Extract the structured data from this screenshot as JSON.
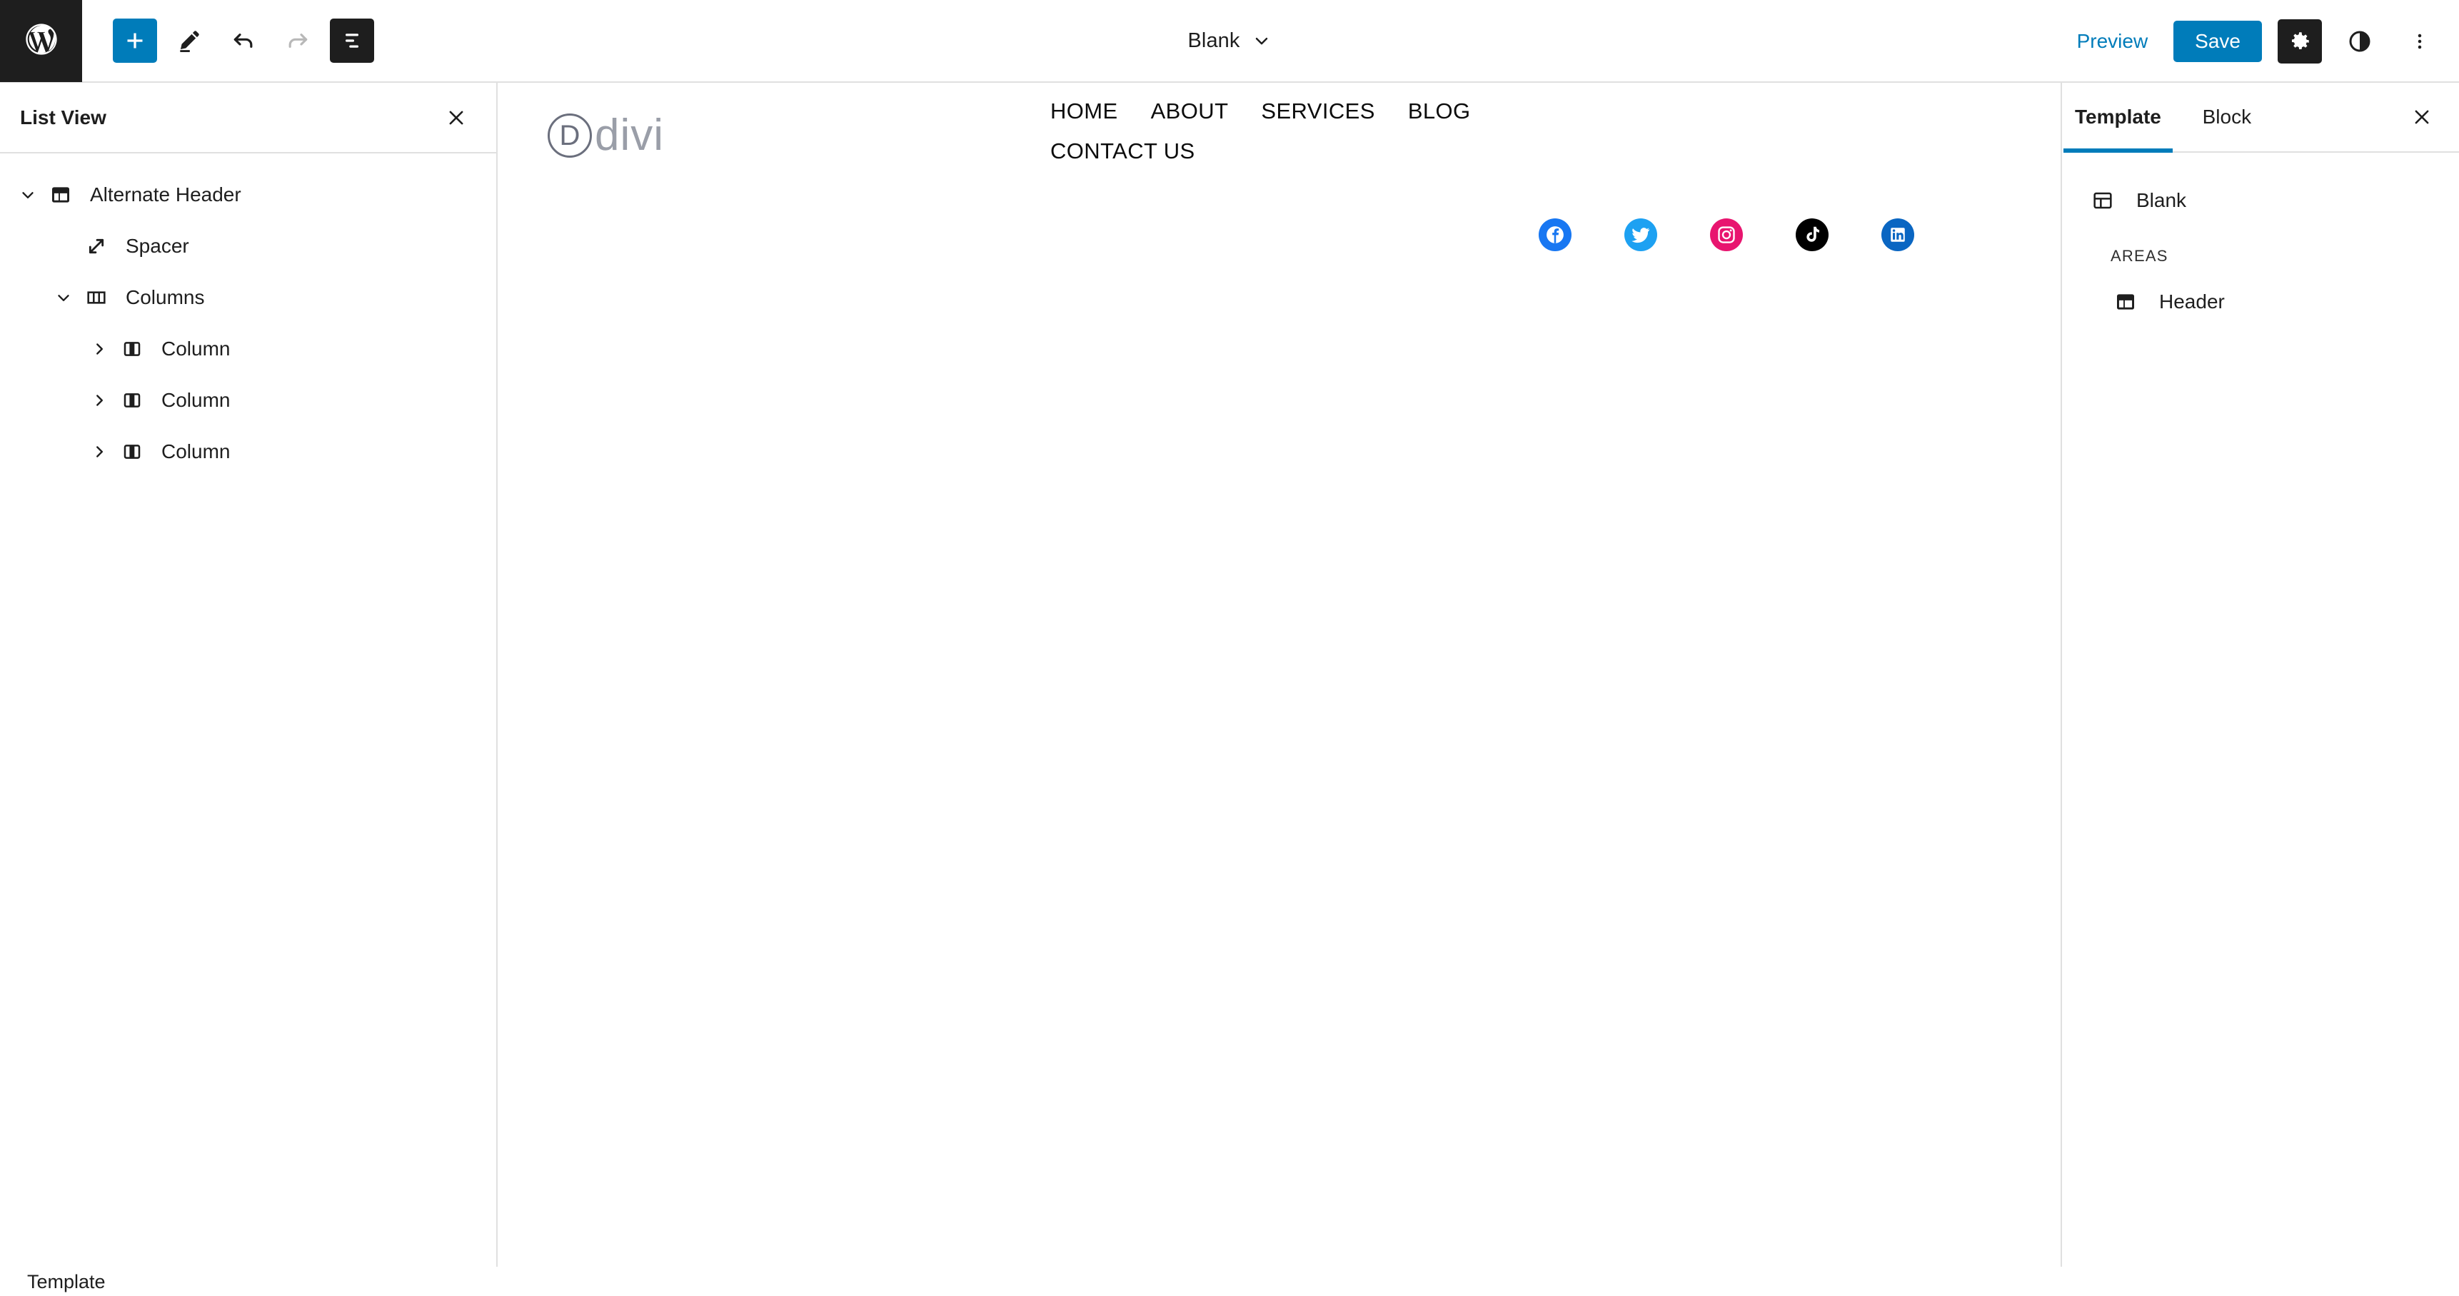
{
  "colors": {
    "accent": "#007cba",
    "dark": "#1e1e1e",
    "border": "#e0e0e0",
    "facebook": "#1877F2",
    "twitter": "#1DA1F2",
    "instagram": "#E8156F",
    "tiktok": "#000000",
    "linkedin": "#0A66C2",
    "divi_gray": "#6b6f7d",
    "divi_word_gray": "#9a9ea8"
  },
  "topbar": {
    "wp_logo_icon": "wordpress-logo-icon",
    "tools": [
      {
        "name": "add-block-button",
        "icon": "plus-icon",
        "style": "primary",
        "interactable": true
      },
      {
        "name": "edit-tools-button",
        "icon": "pencil-icon",
        "style": "plain",
        "interactable": true
      },
      {
        "name": "undo-button",
        "icon": "undo-icon",
        "style": "plain",
        "interactable": true
      },
      {
        "name": "redo-button",
        "icon": "redo-icon",
        "style": "disabled",
        "interactable": false
      },
      {
        "name": "list-view-button",
        "icon": "list-view-icon",
        "style": "dark",
        "interactable": true
      }
    ],
    "document_title": "Blank",
    "document_title_chevron": "chevron-down-icon",
    "preview_label": "Preview",
    "save_label": "Save",
    "settings_icon": "gear-icon",
    "styles_icon": "half-circle-contrast-icon",
    "options_icon": "vertical-dots-icon"
  },
  "list_view": {
    "title": "List View",
    "close_icon": "close-icon",
    "items": [
      {
        "label": "Alternate Header",
        "icon": "template-part-icon",
        "depth": 0,
        "twisty": "chevron-down-icon"
      },
      {
        "label": "Spacer",
        "icon": "spacer-resize-icon",
        "depth": 1,
        "twisty": "none"
      },
      {
        "label": "Columns",
        "icon": "columns-icon",
        "depth": 1,
        "twisty": "chevron-down-icon"
      },
      {
        "label": "Column",
        "icon": "column-icon",
        "depth": 2,
        "twisty": "chevron-right-icon"
      },
      {
        "label": "Column",
        "icon": "column-icon",
        "depth": 2,
        "twisty": "chevron-right-icon"
      },
      {
        "label": "Column",
        "icon": "column-icon",
        "depth": 2,
        "twisty": "chevron-right-icon"
      }
    ]
  },
  "canvas": {
    "logo": {
      "mark_letter": "D",
      "word": "divi"
    },
    "nav_links": [
      "HOME",
      "ABOUT",
      "SERVICES",
      "BLOG",
      "CONTACT US"
    ],
    "social_icons": [
      {
        "name": "facebook-icon",
        "label": "Facebook",
        "color": "#1877F2"
      },
      {
        "name": "twitter-icon",
        "label": "Twitter",
        "color": "#1DA1F2"
      },
      {
        "name": "instagram-icon",
        "label": "Instagram",
        "color": "#E8156F"
      },
      {
        "name": "tiktok-icon",
        "label": "TikTok",
        "color": "#000000"
      },
      {
        "name": "linkedin-icon",
        "label": "LinkedIn",
        "color": "#0A66C2"
      }
    ],
    "add_block_icon": "plus-icon"
  },
  "right_panel": {
    "tabs": [
      {
        "label": "Template",
        "active": true
      },
      {
        "label": "Block",
        "active": false
      }
    ],
    "close_icon": "close-icon",
    "template_name": "Blank",
    "template_icon": "template-icon",
    "areas_heading": "AREAS",
    "areas": [
      {
        "label": "Header",
        "icon": "template-part-icon"
      }
    ]
  },
  "statusbar": {
    "label": "Template"
  }
}
